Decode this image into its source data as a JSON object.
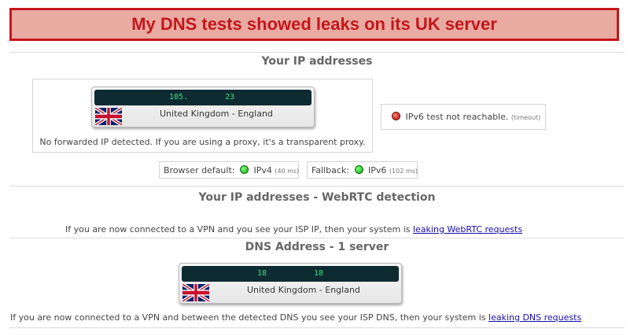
{
  "banner": {
    "text": "My DNS tests showed leaks on its UK server"
  },
  "ip_section": {
    "title": "Your IP addresses",
    "ip": {
      "part1": "185.",
      "part2": "23",
      "country": "United Kingdom - England",
      "flag": "uk-flag"
    },
    "note": "No forwarded IP detected. If you are using a proxy, it's a transparent proxy.",
    "ipv6": {
      "label": "IPv6 test not reachable.",
      "detail": "(timeout)",
      "status_color": "#b3140a"
    },
    "browser_default": {
      "label": "Browser default:",
      "protocol": "IPv4",
      "latency": "(40 ms)"
    },
    "fallback": {
      "label": "Fallback:",
      "protocol": "IPv6",
      "latency": "(102 ms)"
    }
  },
  "webrtc_section": {
    "title": "Your IP addresses - WebRTC detection",
    "text": "If you are now connected to a VPN and you see your ISP IP, then your system is",
    "link": "leaking WebRTC requests"
  },
  "dns_section": {
    "title": "DNS Address - 1 server",
    "ip": {
      "part1": "18",
      "part2": "18",
      "country": "United Kingdom - England",
      "flag": "uk-flag"
    },
    "text": "If you are now connected to a VPN and between the detected DNS you see your ISP DNS, then your system is",
    "link": "leaking DNS requests"
  },
  "colors": {
    "banner_bg": "#e9aaa1",
    "banner_border": "#c4161c",
    "ip_bar": "#0e2b32",
    "ip_text": "#33e07a",
    "ok": "#11a611"
  }
}
